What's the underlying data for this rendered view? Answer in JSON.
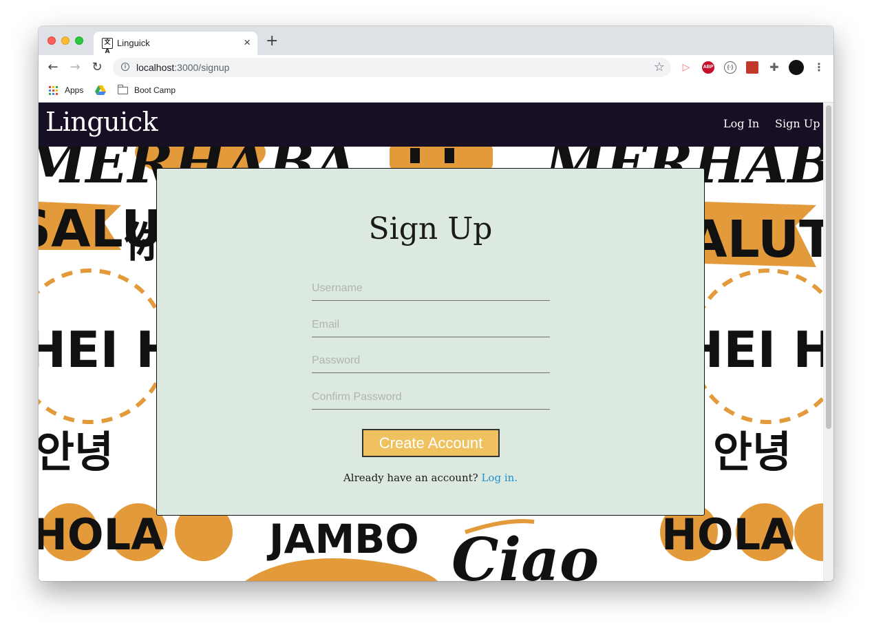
{
  "browser": {
    "tab_title": "Linguick",
    "tab_favicon_text": "文A",
    "close_glyph": "×",
    "new_tab_glyph": "+",
    "url_host": "localhost",
    "url_path": ":3000/signup",
    "bookmarks": [
      {
        "label": "Apps",
        "icon": "apps-grid-icon"
      },
      {
        "label": "",
        "icon": "google-drive-icon"
      },
      {
        "label": "Boot Camp",
        "icon": "folder-icon"
      }
    ],
    "extensions": [
      "cast-icon",
      "adblock-plus-icon",
      "code-icon",
      "extension-red-icon",
      "puzzle-icon"
    ],
    "ext_abp_text": "ABP"
  },
  "site": {
    "brand": "Linguick",
    "nav": {
      "login": "Log In",
      "signup": "Sign Up"
    },
    "background_words": [
      "MERHABA",
      "SALUT",
      "你好",
      "HEI HEI",
      "안녕",
      "HOLA",
      "JAMBO",
      "Ciao"
    ]
  },
  "signup": {
    "title": "Sign Up",
    "fields": {
      "username": {
        "placeholder": "Username",
        "value": ""
      },
      "email": {
        "placeholder": "Email",
        "value": ""
      },
      "password": {
        "placeholder": "Password",
        "value": ""
      },
      "confirm": {
        "placeholder": "Confirm Password",
        "value": ""
      }
    },
    "submit_label": "Create Account",
    "footer_text": "Already have an account? ",
    "footer_link": "Log in."
  },
  "colors": {
    "nav_bg": "#170f23",
    "card_bg": "#dce9e0",
    "button_bg": "#efc15f",
    "link": "#1e8fd1",
    "art_orange": "#e39a3a"
  }
}
